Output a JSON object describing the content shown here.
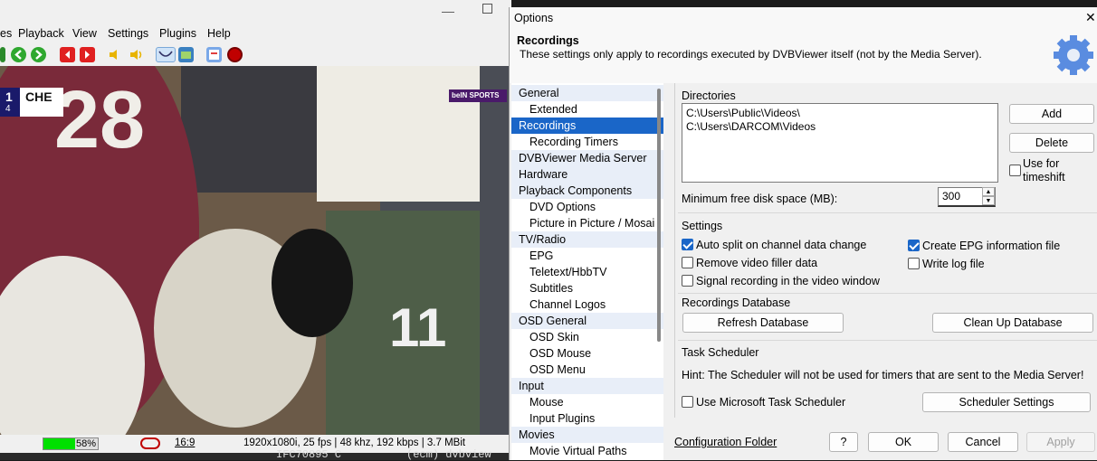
{
  "player": {
    "menu": [
      "es",
      "Playback",
      "View",
      "Settings",
      "Plugins",
      "Help"
    ],
    "score_team": "CHE",
    "score_num": "1",
    "score_sub": "4",
    "broadcaster_logo": "beIN SPORTS",
    "volume_percent": 58,
    "volume_label": "58%",
    "aspect_label": "16:9",
    "status_info": "1920x1080i, 25 fps | 48 khz, 192 kbps | 3.7 MBit",
    "bottom_text": "IFC70895 C          (ecm) dvbview"
  },
  "dialog": {
    "title": "Options",
    "close_glyph": "✕",
    "header": {
      "title": "Recordings",
      "subtitle": "These settings only apply to recordings executed by DVBViewer itself (not by the Media Server)."
    },
    "tree": [
      {
        "label": "General",
        "level": 0
      },
      {
        "label": "Extended",
        "level": 1
      },
      {
        "label": "Recordings",
        "level": 0,
        "selected": true
      },
      {
        "label": "Recording Timers",
        "level": 1
      },
      {
        "label": "DVBViewer Media Server",
        "level": 0
      },
      {
        "label": "Hardware",
        "level": 0
      },
      {
        "label": "Playback Components",
        "level": 0
      },
      {
        "label": "DVD Options",
        "level": 1
      },
      {
        "label": "Picture in Picture / Mosai",
        "level": 1
      },
      {
        "label": "TV/Radio",
        "level": 0
      },
      {
        "label": "EPG",
        "level": 1
      },
      {
        "label": "Teletext/HbbTV",
        "level": 1
      },
      {
        "label": "Subtitles",
        "level": 1
      },
      {
        "label": "Channel Logos",
        "level": 1
      },
      {
        "label": "OSD General",
        "level": 0
      },
      {
        "label": "OSD Skin",
        "level": 1
      },
      {
        "label": "OSD Mouse",
        "level": 1
      },
      {
        "label": "OSD Menu",
        "level": 1
      },
      {
        "label": "Input",
        "level": 0
      },
      {
        "label": "Mouse",
        "level": 1
      },
      {
        "label": "Input Plugins",
        "level": 1
      },
      {
        "label": "Movies",
        "level": 0
      },
      {
        "label": "Movie Virtual Paths",
        "level": 1
      }
    ],
    "directories": {
      "label": "Directories",
      "paths": [
        "C:\\Users\\Public\\Videos\\",
        "C:\\Users\\DARCOM\\Videos"
      ],
      "add_label": "Add",
      "delete_label": "Delete",
      "timeshift_label_1": "Use for",
      "timeshift_label_2": "timeshift",
      "timeshift_checked": false,
      "min_free_label": "Minimum free disk space (MB):",
      "min_free_value": "300"
    },
    "settings": {
      "label": "Settings",
      "auto_split": {
        "label": "Auto split on channel data change",
        "checked": true
      },
      "remove_filler": {
        "label": "Remove video filler data",
        "checked": false
      },
      "signal_recording": {
        "label": "Signal recording in the video window",
        "checked": false
      },
      "create_epg": {
        "label": "Create EPG information file",
        "checked": true
      },
      "write_log": {
        "label": "Write log file",
        "checked": false
      }
    },
    "database": {
      "label": "Recordings Database",
      "refresh_label": "Refresh Database",
      "cleanup_label": "Clean Up Database"
    },
    "scheduler": {
      "label": "Task Scheduler",
      "hint": "Hint: The Scheduler will not be used for timers that are sent to the Media Server!",
      "use_label": "Use Microsoft Task Scheduler",
      "use_checked": false,
      "settings_label": "Scheduler Settings"
    },
    "footer": {
      "config_folder": "Configuration Folder",
      "help_label": "?",
      "ok_label": "OK",
      "cancel_label": "Cancel",
      "apply_label": "Apply"
    }
  },
  "colors": {
    "accent": "#1a66c8",
    "volume_green": "#00e000",
    "tree_parent_bg": "#e8eef8"
  }
}
